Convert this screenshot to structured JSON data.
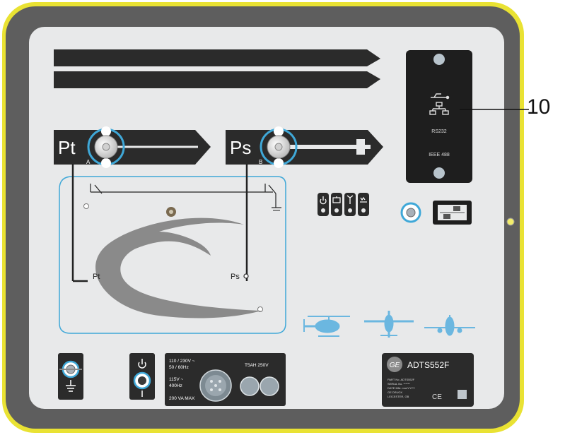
{
  "callout": {
    "number": "10"
  },
  "ports": {
    "pt": {
      "label": "Pt",
      "sub": "A"
    },
    "ps": {
      "label": "Ps",
      "sub": "B"
    }
  },
  "pneumatic": {
    "pt_label": "Pt",
    "ps_label": "Ps"
  },
  "connector_card": {
    "line1": "RS232",
    "line2": "IEEE 488"
  },
  "power_panel": {
    "voltage1": "110 / 230V ~",
    "freq1": "50 / 60Hz",
    "voltage2": "115V ~",
    "freq2": "400Hz",
    "max": "200 VA MAX",
    "fuse": "T5AH 250V"
  },
  "nameplate": {
    "model": "ADTS552F",
    "brand_logo": "GE",
    "lines": [
      "PART No. ADTS552F",
      "SERIAL No. ******",
      "DATE Mfd: mm/YYYY",
      "GE DRUCK",
      "LEICESTER, GB"
    ],
    "ce_mark": "CE"
  },
  "icons": {
    "usb": "usb-icon",
    "network": "network-icon",
    "power": "power-icon",
    "battery": "battery-icon",
    "service": "service-icon",
    "leak": "leak-icon",
    "helicopter": "helicopter-icon",
    "plane_top": "airplane-top-icon",
    "plane_front": "airplane-front-icon",
    "earth": "earth-icon"
  },
  "colors": {
    "frame_yellow": "#e9e233",
    "body_gray": "#5e5e5e",
    "face": "#e8e9ea",
    "accent_blue": "#3fa8d8"
  }
}
